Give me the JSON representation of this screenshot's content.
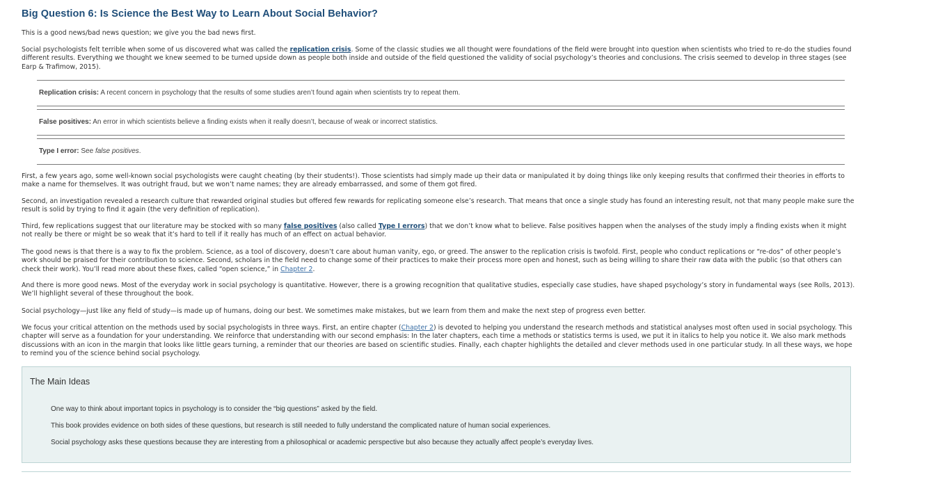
{
  "title": "Big Question 6: Is Science the Best Way to Learn About Social Behavior?",
  "p1": "This is a good news/bad news question; we give you the bad news first.",
  "p2": {
    "before": "Social psychologists felt terrible when some of us discovered what was called the ",
    "link": "replication crisis",
    "after": ". Some of the classic studies we all thought were foundations of the field were brought into question when scientists who tried to re-do the studies found different results. Everything we thought we knew seemed to be turned upside down as people both inside and outside of the field questioned the validity of social psychology’s theories and conclusions. The crisis seemed to develop in three stages (see Earp & Trafimow, 2015)."
  },
  "glossary": [
    {
      "term": "Replication crisis:",
      "definition": " A recent concern in psychology that the results of some studies aren’t found again when scientists try to repeat them."
    },
    {
      "term": "False positives:",
      "definition": " An error in which scientists believe a finding exists when it really doesn’t, because of weak or incorrect statistics."
    },
    {
      "term": "Type I error:",
      "definition_prefix": " See ",
      "definition_italic": "false positives",
      "definition_suffix": "."
    }
  ],
  "p3": "First, a few years ago, some well-known social psychologists were caught cheating (by their students!). Those scientists had simply made up their data or manipulated it by doing things like only keeping results that confirmed their theories in efforts to make a name for themselves. It was outright fraud, but we won’t name names; they are already embarrassed, and some of them got fired.",
  "p4": "Second, an investigation revealed a research culture that rewarded original studies but offered few rewards for replicating someone else’s research. That means that once a single study has found an interesting result, not that many people make sure the result is solid by trying to find it again (the very definition of replication).",
  "p5": {
    "before": "Third, few replications suggest that our literature may be stocked with so many ",
    "link1": "false positives",
    "middle": " (also called ",
    "link2": "Type I errors",
    "after": ") that we don’t know what to believe. False positives happen when the analyses of the study imply a finding exists when it might not really be there or might be so weak that it’s hard to tell if it really has much of an effect on actual behavior."
  },
  "p6": {
    "before": "The good news is that there is a way to fix the problem. Science, as a tool of discovery, doesn’t care about human vanity, ego, or greed. The answer to the replication crisis is twofold. First, people who conduct replications or “re-dos” of other people’s work should be praised for their contribution to science. Second, scholars in the field need to change some of their practices to make their process more open and honest, such as being willing to share their raw data with the public (so that others can check their work). You’ll read more about these fixes, called “open science,” in ",
    "link": "Chapter 2",
    "after": "."
  },
  "p7": "And there is more good news. Most of the everyday work in social psychology is quantitative. However, there is a growing recognition that qualitative studies, especially case studies, have shaped psychology’s story in fundamental ways (see Rolls, 2013). We’ll highlight several of these throughout the book.",
  "p8": "Social psychology—just like any field of study—is made up of humans, doing our best. We sometimes make mistakes, but we learn from them and make the next step of progress even better.",
  "p9": {
    "before": "We focus your critical attention on the methods used by social psychologists in three ways. First, an entire chapter (",
    "link": "Chapter 2",
    "after": ") is devoted to helping you understand the research methods and statistical analyses most often used in social psychology. This chapter will serve as a foundation for your understanding. We reinforce that understanding with our second emphasis: In the later chapters, each time a methods or statistics terms is used, we put it in italics to help you notice it. We also mark methods discussions with an icon in the margin that looks like little gears turning, a reminder that our theories are based on scientific studies. Finally, each chapter highlights the detailed and clever methods used in one particular study. In all these ways, we hope to remind you of the science behind social psychology."
  },
  "main_ideas": {
    "heading": "The Main Ideas",
    "items": [
      "One way to think about important topics in psychology is to consider the “big questions” asked by the field.",
      "This book provides evidence on both sides of these questions, but research is still needed to fully understand the complicated nature of human social experiences.",
      "Social psychology asks these questions because they are interesting from a philosophical or academic perspective but also because they actually affect people’s everyday lives."
    ]
  }
}
